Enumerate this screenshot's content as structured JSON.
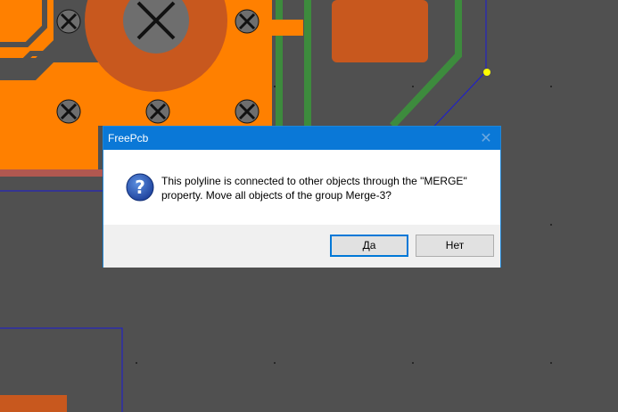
{
  "dialog": {
    "title": "FreePcb",
    "close_icon": "close-icon",
    "message": "This polyline is connected to other objects through the \"MERGE\" property. Move all objects of the group Merge-3?",
    "icon": "question-icon",
    "yes_label": "Да",
    "no_label": "Нет"
  },
  "colors": {
    "background": "#505050",
    "copper": "#ff8000",
    "copper_dark": "#c8581e",
    "trace_green": "#3d8b3d",
    "outline_blue": "#1a1ad6",
    "accent": "#0078d7"
  }
}
